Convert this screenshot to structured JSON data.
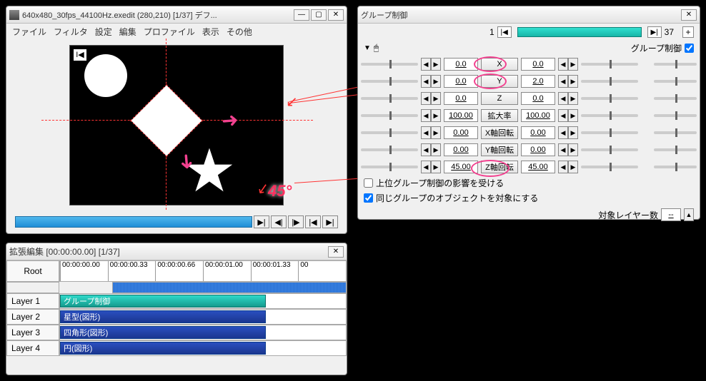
{
  "preview": {
    "title": "640x480_30fps_44100Hz.exedit (280,210)  [1/37] デフ...",
    "menu": [
      "ファイル",
      "フィルタ",
      "設定",
      "編集",
      "プロファイル",
      "表示",
      "その他"
    ],
    "keyframe_ind": "I◀",
    "transport": [
      "▶|",
      "◀|",
      "|▶",
      "|◀",
      "▶|"
    ]
  },
  "overlay": {
    "rotation_label": "45°"
  },
  "props": {
    "title": "グループ制御",
    "frame_start": "1",
    "frame_end": "37",
    "header_label": "グループ制御",
    "params": [
      {
        "label": "X",
        "left": "0.0",
        "right": "0.0"
      },
      {
        "label": "Y",
        "left": "0.0",
        "right": "2.0"
      },
      {
        "label": "Z",
        "left": "0.0",
        "right": "0.0"
      },
      {
        "label": "拡大率",
        "left": "100.00",
        "right": "100.00"
      },
      {
        "label": "X軸回転",
        "left": "0.00",
        "right": "0.00"
      },
      {
        "label": "Y軸回転",
        "left": "0.00",
        "right": "0.00"
      },
      {
        "label": "Z軸回転",
        "left": "45.00",
        "right": "45.00"
      }
    ],
    "check1": "上位グループ制御の影響を受ける",
    "check2": "同じグループのオブジェクトを対象にする",
    "footer_label": "対象レイヤー数",
    "footer_value": "--"
  },
  "timeline": {
    "title": "拡張編集 [00:00:00.00] [1/37]",
    "root": "Root",
    "ticks": [
      "00:00:00.00",
      "00:00:00.33",
      "00:00:00.66",
      "00:00:01.00",
      "00:00:01.33",
      "00"
    ],
    "layers": [
      {
        "label": "Layer 1",
        "clip": "グループ制御",
        "class": "clip-group",
        "width": "72%"
      },
      {
        "label": "Layer 2",
        "clip": "星型(図形)",
        "class": "clip-shape",
        "width": "72%"
      },
      {
        "label": "Layer 3",
        "clip": "四角形(図形)",
        "class": "clip-shape",
        "width": "72%"
      },
      {
        "label": "Layer 4",
        "clip": "円(図形)",
        "class": "clip-shape",
        "width": "72%"
      }
    ]
  }
}
